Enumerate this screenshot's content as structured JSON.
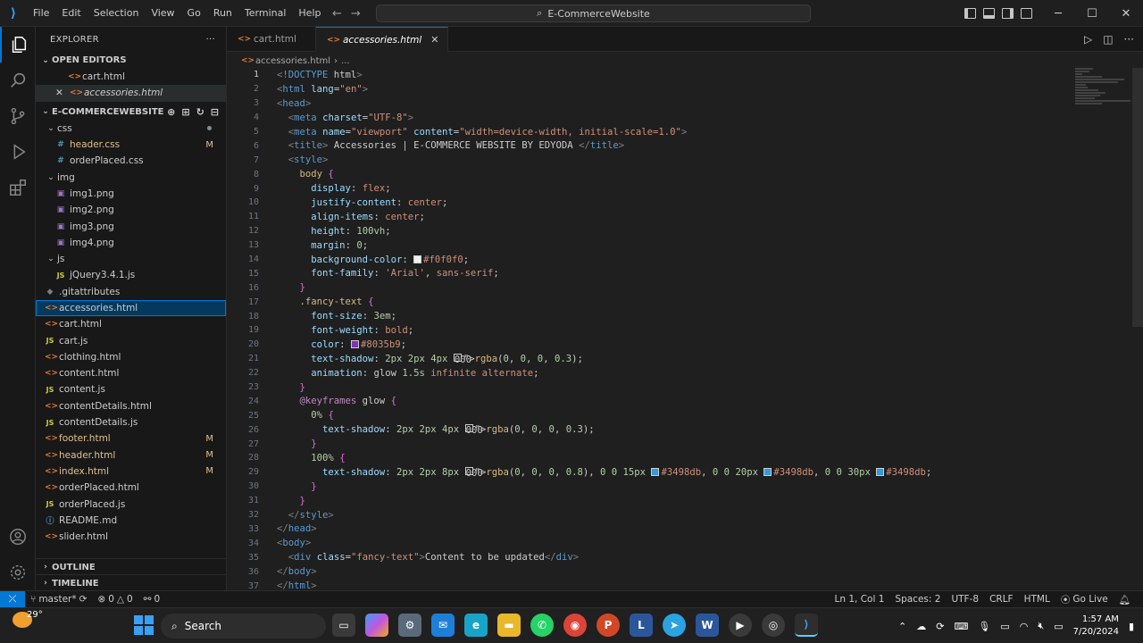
{
  "menu": [
    "File",
    "Edit",
    "Selection",
    "View",
    "Go",
    "Run",
    "Terminal",
    "Help"
  ],
  "command_center": "E-CommerceWebsite",
  "sidebar": {
    "title": "EXPLORER",
    "open_editors_label": "OPEN EDITORS",
    "open_editors": [
      "cart.html",
      "accessories.html"
    ],
    "project_label": "E-COMMERCEWEBSITE",
    "tree": [
      {
        "name": "css",
        "type": "folder",
        "depth": 1
      },
      {
        "name": "header.css",
        "type": "css",
        "depth": 2,
        "badge": "M"
      },
      {
        "name": "orderPlaced.css",
        "type": "css",
        "depth": 2
      },
      {
        "name": "img",
        "type": "folder",
        "depth": 1
      },
      {
        "name": "img1.png",
        "type": "img",
        "depth": 2
      },
      {
        "name": "img2.png",
        "type": "img",
        "depth": 2
      },
      {
        "name": "img3.png",
        "type": "img",
        "depth": 2
      },
      {
        "name": "img4.png",
        "type": "img",
        "depth": 2
      },
      {
        "name": "js",
        "type": "folder",
        "depth": 1
      },
      {
        "name": "jQuery3.4.1.js",
        "type": "js",
        "depth": 2
      },
      {
        "name": ".gitattributes",
        "type": "git",
        "depth": 1
      },
      {
        "name": "accessories.html",
        "type": "html",
        "depth": 1,
        "selected": true
      },
      {
        "name": "cart.html",
        "type": "html",
        "depth": 1
      },
      {
        "name": "cart.js",
        "type": "js",
        "depth": 1
      },
      {
        "name": "clothing.html",
        "type": "html",
        "depth": 1
      },
      {
        "name": "content.html",
        "type": "html",
        "depth": 1
      },
      {
        "name": "content.js",
        "type": "js",
        "depth": 1
      },
      {
        "name": "contentDetails.html",
        "type": "html",
        "depth": 1
      },
      {
        "name": "contentDetails.js",
        "type": "js",
        "depth": 1
      },
      {
        "name": "footer.html",
        "type": "html",
        "depth": 1,
        "badge": "M"
      },
      {
        "name": "header.html",
        "type": "html",
        "depth": 1,
        "badge": "M"
      },
      {
        "name": "index.html",
        "type": "html",
        "depth": 1,
        "badge": "M"
      },
      {
        "name": "orderPlaced.html",
        "type": "html",
        "depth": 1
      },
      {
        "name": "orderPlaced.js",
        "type": "js",
        "depth": 1
      },
      {
        "name": "README.md",
        "type": "info",
        "depth": 1
      },
      {
        "name": "slider.html",
        "type": "html",
        "depth": 1
      }
    ],
    "outline_label": "OUTLINE",
    "timeline_label": "TIMELINE"
  },
  "tabs": [
    {
      "label": "cart.html",
      "active": false
    },
    {
      "label": "accessories.html",
      "active": true
    }
  ],
  "breadcrumb": [
    "accessories.html",
    "..."
  ],
  "code_lines": [
    "<!DOCTYPE html>",
    "<html lang=\"en\">",
    "<head>",
    "  <meta charset=\"UTF-8\">",
    "  <meta name=\"viewport\" content=\"width=device-width, initial-scale=1.0\">",
    "  <title> Accessories | E-COMMERCE WEBSITE BY EDYODA </title>",
    "  <style>",
    "    body {",
    "      display: flex;",
    "      justify-content: center;",
    "      align-items: center;",
    "      height: 100vh;",
    "      margin: 0;",
    "      background-color: #f0f0f0;",
    "      font-family: 'Arial', sans-serif;",
    "    }",
    "    .fancy-text {",
    "      font-size: 3em;",
    "      font-weight: bold;",
    "      color: #8035b9;",
    "      text-shadow: 2px 2px 4px rgba(0, 0, 0, 0.3);",
    "      animation: glow 1.5s infinite alternate;",
    "    }",
    "    @keyframes glow {",
    "      0% {",
    "        text-shadow: 2px 2px 4px rgba(0, 0, 0, 0.3);",
    "      }",
    "      100% {",
    "        text-shadow: 2px 2px 8px rgba(0, 0, 0, 0.8), 0 0 15px #3498db, 0 0 20px #3498db, 0 0 30px #3498db;",
    "      }",
    "    }",
    "  </style>",
    "</head>",
    "<body>",
    "  <div class=\"fancy-text\">Content to be updated</div>",
    "</body>",
    "</html>"
  ],
  "status": {
    "branch": "master*",
    "errors": "0",
    "warnings": "0",
    "ports": "0",
    "position": "Ln 1, Col 1",
    "spaces": "Spaces: 2",
    "encoding": "UTF-8",
    "eol": "CRLF",
    "language": "HTML",
    "golive": "Go Live"
  },
  "taskbar": {
    "temperature": "29°",
    "search_label": "Search",
    "time": "1:57 AM",
    "date": "7/20/2024"
  },
  "colors": {
    "accent": "#0078d4",
    "swatch_bg": "#f0f0f0",
    "swatch_purple": "#8035b9",
    "swatch_blue": "#3498db"
  }
}
